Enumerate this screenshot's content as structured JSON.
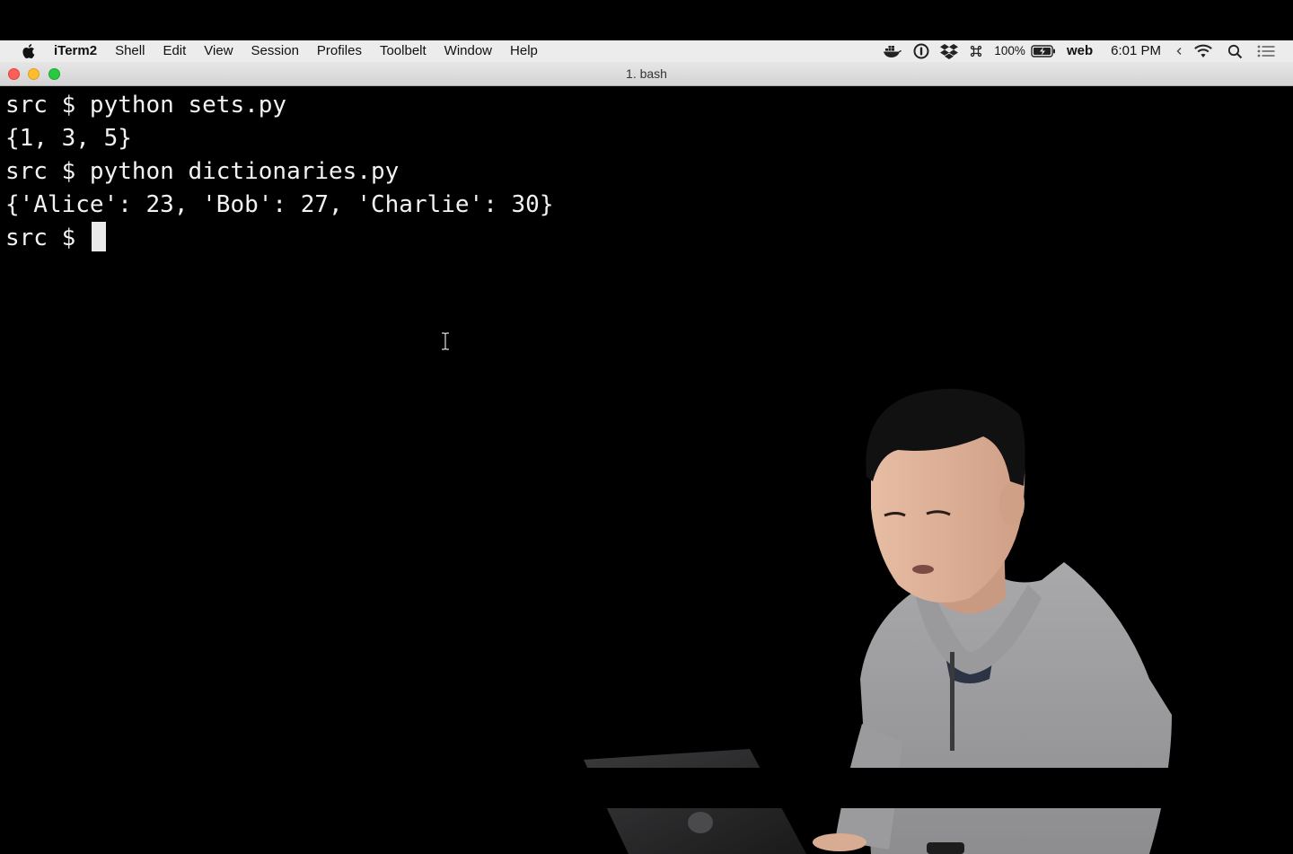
{
  "menubar": {
    "app_name": "iTerm2",
    "items": [
      "Shell",
      "Edit",
      "View",
      "Session",
      "Profiles",
      "Toolbelt",
      "Window",
      "Help"
    ],
    "status": {
      "battery_percent": "100%",
      "user_name": "web",
      "clock": "6:01 PM"
    },
    "icons": [
      "apple-icon",
      "docker-icon",
      "onepassword-icon",
      "dropbox-icon",
      "command-icon",
      "battery-icon",
      "caret-icon",
      "wifi-icon",
      "search-icon",
      "notification-list-icon"
    ]
  },
  "window": {
    "title": "1. bash"
  },
  "terminal": {
    "lines": [
      "src $ python sets.py",
      "{1, 3, 5}",
      "src $ python dictionaries.py",
      "{'Alice': 23, 'Bob': 27, 'Charlie': 30}",
      "src $ "
    ]
  },
  "colors": {
    "terminal_bg": "#000000",
    "terminal_fg": "#f2f2f2",
    "menubar_bg": "#ececec",
    "close": "#fd5f57",
    "minimize": "#febc2e",
    "zoom": "#28c840"
  }
}
